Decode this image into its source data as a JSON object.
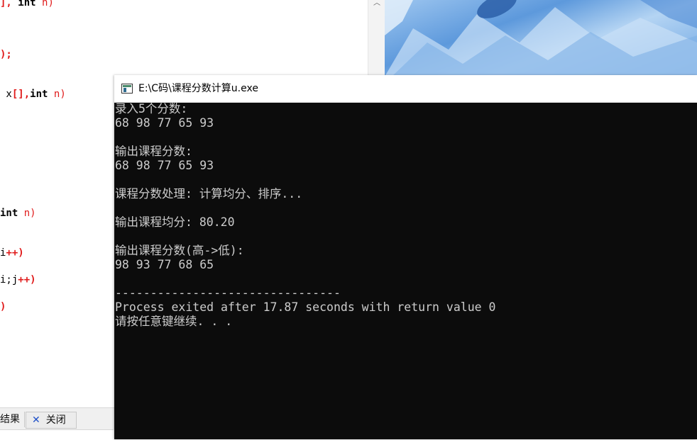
{
  "editor": {
    "lines": [
      {
        "parts": [
          {
            "c": "pn",
            "t": "],"
          },
          {
            "c": "",
            "t": " "
          },
          {
            "c": "kw",
            "t": "int"
          },
          {
            "c": "",
            "t": " "
          },
          {
            "c": "nm",
            "t": "n)"
          }
        ]
      },
      {
        "parts": [
          {
            "c": "pn",
            "t": ");"
          }
        ]
      },
      {
        "parts": [
          {
            "c": "",
            "t": " x"
          },
          {
            "c": "pn",
            "t": "[],"
          },
          {
            "c": "kw",
            "t": "int"
          },
          {
            "c": "",
            "t": " "
          },
          {
            "c": "nm",
            "t": "n)"
          }
        ]
      },
      {
        "parts": [
          {
            "c": "kw",
            "t": "int"
          },
          {
            "c": "",
            "t": " "
          },
          {
            "c": "nm",
            "t": "n)"
          }
        ]
      },
      {
        "parts": [
          {
            "c": "",
            "t": "i"
          },
          {
            "c": "pn",
            "t": "++)"
          }
        ]
      },
      {
        "parts": [
          {
            "c": "",
            "t": "i;j"
          },
          {
            "c": "pn",
            "t": "++)"
          }
        ]
      },
      {
        "parts": [
          {
            "c": "pn",
            "t": ")"
          }
        ]
      }
    ]
  },
  "bottom_tabs": {
    "results_label": "结果",
    "close_label": "关闭"
  },
  "console": {
    "title": "E:\\C码\\课程分数计算u.exe",
    "lines": [
      "录入5个分数:",
      "68 98 77 65 93",
      "",
      "输出课程分数:",
      "68 98 77 65 93",
      "",
      "课程分数处理: 计算均分、排序...",
      "",
      "输出课程均分: 80.20",
      "",
      "输出课程分数(高->低):",
      "98 93 77 68 65",
      "",
      "--------------------------------",
      "Process exited after 17.87 seconds with return value 0",
      "请按任意键继续. . ."
    ]
  },
  "colors": {
    "console_bg": "#0c0c0c",
    "console_text": "#cccccc",
    "code_accent": "#e01b1b"
  }
}
